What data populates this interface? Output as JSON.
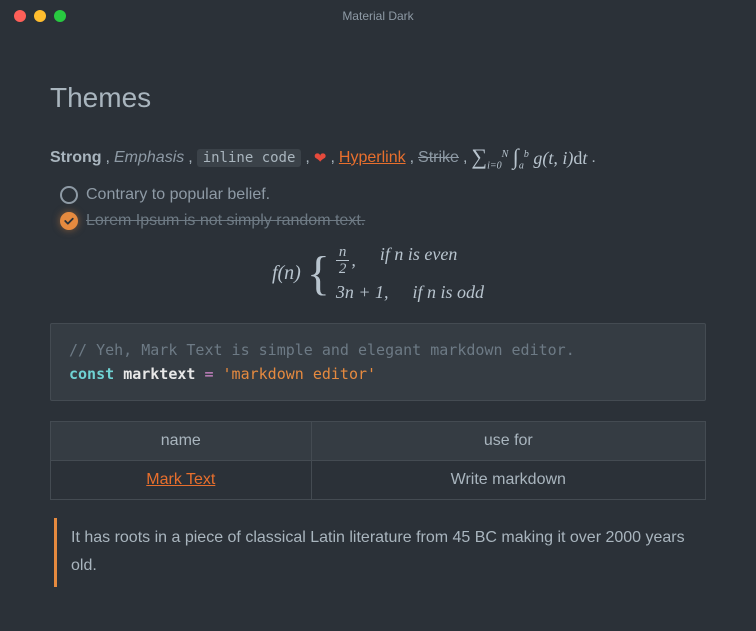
{
  "window": {
    "title": "Material Dark"
  },
  "heading": "Themes",
  "inline": {
    "strong": "Strong",
    "emphasis": "Emphasis",
    "code": "inline code",
    "hyperlink": "Hyperlink",
    "strike": "Strike",
    "math": "∑ᵢ₌₀ᴺ ∫ₐᵇ g(t,i)dt"
  },
  "tasks": [
    {
      "checked": false,
      "label": "Contrary to popular belief."
    },
    {
      "checked": true,
      "label": "Lorem Ipsum is not simply random text."
    }
  ],
  "math_block": {
    "fn": "f(n)",
    "cases": [
      {
        "expr_frac": {
          "num": "n",
          "den": "2"
        },
        "cond": "if n is even"
      },
      {
        "expr": "3n + 1,",
        "cond": "if n is odd"
      }
    ]
  },
  "code": {
    "comment": "// Yeh, Mark Text is simple and elegant markdown editor.",
    "keyword": "const",
    "identifier": "marktext",
    "operator": "=",
    "string": "'markdown editor'"
  },
  "table": {
    "headers": [
      "name",
      "use for"
    ],
    "row": {
      "name": "Mark Text",
      "use": "Write markdown"
    }
  },
  "quote": "It has roots in a piece of classical Latin literature from 45 BC making it over 2000 years old."
}
